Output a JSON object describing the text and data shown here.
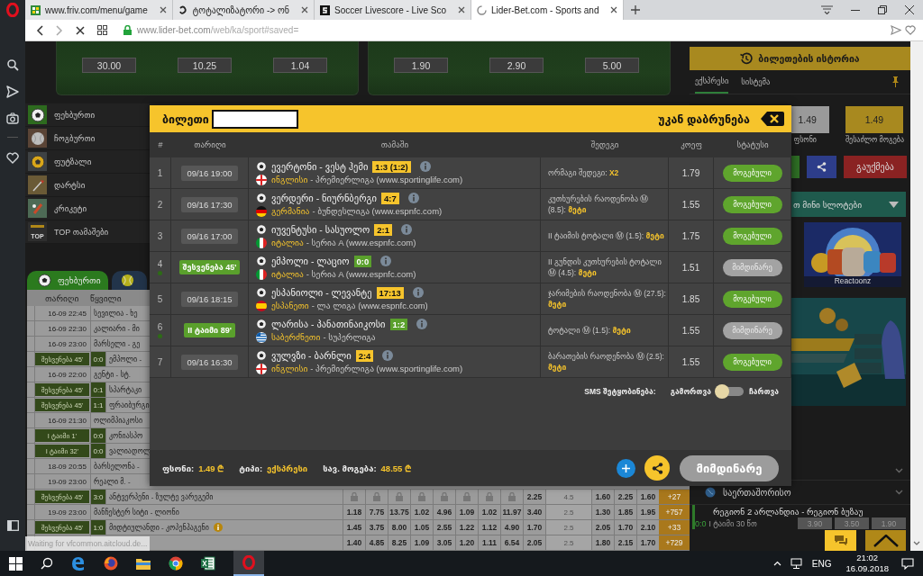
{
  "browser": {
    "tabs": [
      {
        "title": "www.friv.com/menu/game",
        "kind": "friv",
        "selected": false
      },
      {
        "title": "ტოტალიზატორი -> ონ",
        "kind": "letter",
        "selected": false
      },
      {
        "title": "Soccer Livescore - Live Sco",
        "kind": "soccer",
        "selected": false
      },
      {
        "title": "Lider-Bet.com - Sports and",
        "kind": "loading",
        "selected": true
      }
    ],
    "address": {
      "host": "www.lider-bet.com",
      "path": "/web/ka/sport#saved="
    }
  },
  "match_cards": [
    {
      "odds": [
        "30.00",
        "10.25",
        "1.04"
      ]
    },
    {
      "odds": [
        "1.90",
        "2.90",
        "5.00"
      ]
    }
  ],
  "sports": [
    {
      "name": "ფეხბურთი",
      "kind": "football"
    },
    {
      "name": "ჩოგბურთი",
      "kind": "tennis"
    },
    {
      "name": "ფუტზალი",
      "kind": "futsal"
    },
    {
      "name": "დარტსი",
      "kind": "darts"
    },
    {
      "name": "კრიკეტი",
      "kind": "cricket"
    },
    {
      "name": "TOP თამაშები",
      "kind": "top",
      "badge": "TOP"
    }
  ],
  "sport_tabs": [
    {
      "name": "ფეხბურთი",
      "kind": "football",
      "selected": true
    },
    {
      "kind": "tennis",
      "selected": false
    }
  ],
  "events": {
    "columns": [
      "თარიღი",
      "წყვილი"
    ],
    "rows": [
      {
        "live": false,
        "time": "16-09 22:45",
        "match": "სევილია - ხე"
      },
      {
        "live": false,
        "time": "16-09 22:30",
        "match": "კალიარი - მი"
      },
      {
        "live": false,
        "time": "16-09 23:00",
        "match": "მარსელი - გე"
      },
      {
        "live": true,
        "time": "შესვენება 45'",
        "score": "0:0",
        "match": "ემპოლი -"
      },
      {
        "live": false,
        "time": "16-09 22:00",
        "match": "გენტი - სტ."
      },
      {
        "live": true,
        "time": "შესვენება 45'",
        "score": "0:1",
        "match": "სპარტაკი"
      },
      {
        "live": true,
        "time": "შესვენება 45'",
        "score": "1:1",
        "match": "ფრაიბურგი"
      },
      {
        "live": false,
        "time": "16-09 21:30",
        "match": "ოლიმპიაკოსი"
      },
      {
        "live": true,
        "time": "I ტაიმი 1'",
        "score": "0:0",
        "match": "კონიასპო"
      },
      {
        "live": true,
        "time": "I ტაიმი 32'",
        "score": "0:0",
        "match": "ვალიადოლ"
      },
      {
        "live": false,
        "time": "18-09 20:55",
        "match": "ბარსელონა -"
      },
      {
        "live": false,
        "time": "19-09 23:00",
        "match": "რეალი მ. -"
      },
      {
        "live": true,
        "time": "შესვენება 45'",
        "score": "3:0",
        "match": "ანტვერპენი - ზულტე ვარეგემი",
        "odds": [
          {
            "locked": true
          },
          {
            "locked": true
          },
          {
            "locked": true
          },
          {
            "locked": true
          },
          {
            "locked": true
          },
          {
            "locked": true
          },
          {
            "locked": true
          },
          {
            "locked": true
          },
          {
            "locked": false,
            "value": "2.25"
          }
        ],
        "total": "4.5",
        "odds2": [
          "1.60",
          "2.25",
          "1.60"
        ],
        "more": "+27"
      },
      {
        "live": false,
        "time": "19-09 23:00",
        "match": "მანჩესტერ სიტი - ლიონი",
        "odds": [
          {
            "locked": false,
            "value": "1.18"
          },
          {
            "locked": false,
            "value": "7.75"
          },
          {
            "locked": false,
            "value": "13.75"
          },
          {
            "locked": false,
            "value": "1.02"
          },
          {
            "locked": false,
            "value": "4.96"
          },
          {
            "locked": false,
            "value": "1.09"
          },
          {
            "locked": false,
            "value": "1.02"
          },
          {
            "locked": false,
            "value": "11.97"
          },
          {
            "locked": false,
            "value": "3.40"
          }
        ],
        "total": "2.5",
        "odds2": [
          "1.30",
          "1.85",
          "1.95"
        ],
        "more": "+757"
      },
      {
        "live": true,
        "time": "შესვენება 45'",
        "score": "1:0",
        "match": "მიდტიულანდი - კოპენჰაგენი",
        "info": true,
        "odds": [
          {
            "locked": false,
            "value": "1.45"
          },
          {
            "locked": false,
            "value": "3.75"
          },
          {
            "locked": false,
            "value": "8.00"
          },
          {
            "locked": false,
            "value": "1.05"
          },
          {
            "locked": false,
            "value": "2.55"
          },
          {
            "locked": false,
            "value": "1.22"
          },
          {
            "locked": false,
            "value": "1.12"
          },
          {
            "locked": false,
            "value": "4.90"
          },
          {
            "locked": false,
            "value": "1.70"
          }
        ],
        "total": "2.5",
        "odds2": [
          "2.05",
          "1.70",
          "2.10"
        ],
        "more": "+33"
      },
      {
        "odds": [
          {
            "locked": false,
            "value": "1.40"
          },
          {
            "locked": false,
            "value": "4.85"
          },
          {
            "locked": false,
            "value": "8.25"
          },
          {
            "locked": false,
            "value": "1.09"
          },
          {
            "locked": false,
            "value": "3.05"
          },
          {
            "locked": false,
            "value": "1.20"
          },
          {
            "locked": false,
            "value": "1.11"
          },
          {
            "locked": false,
            "value": "6.54"
          },
          {
            "locked": false,
            "value": "2.05"
          }
        ],
        "total": "2.5",
        "odds2": [
          "1.80",
          "2.15",
          "1.70"
        ],
        "more": "+729"
      }
    ]
  },
  "right_panel": {
    "history_button": "ბილეთების ისტორია",
    "ticket_tabs": [
      {
        "label": "ექსპრესი",
        "selected": true
      },
      {
        "label": "სისტემა",
        "selected": false
      }
    ],
    "stake": {
      "value": "1.49",
      "label": "ფსონი"
    },
    "possible_win": {
      "value": "1.49",
      "label": "შესაძლო მოგება"
    },
    "cancel_button": "გაუქმება",
    "slots_banner": "თ მინი სლოტები",
    "game_tile": "Reactoonz",
    "live_section": {
      "category": "საერთაშორისო",
      "match": "რეგიონ 2 არლანდია - რეგიონ ბუზაუ",
      "score": "0:0",
      "period": "I ტაიმი 30 წთ",
      "odds": [
        "3.90",
        "3.50",
        "1.90"
      ]
    }
  },
  "ticket": {
    "title": "ბილეთი",
    "back": "უკან დაბრუნება",
    "columns": [
      "#",
      "თარიღი",
      "თამაში",
      "შედეგი",
      "კოეფ",
      "სტატუსი"
    ],
    "bets": [
      {
        "n": "1",
        "live": false,
        "time": "09/16 19:00",
        "match": "ევერტონი - ვესტ ჰემი",
        "score": "1:3 (1:2)",
        "flag": {
          "kind": "england"
        },
        "country": "ინგლისი",
        "league": "- პრემიერლიგა (www.sportinglife.com)",
        "bet": "ორმაგი შედეგი:",
        "pick": "X2",
        "odd": "1.79",
        "status": "მოგებული",
        "kind": "won"
      },
      {
        "n": "2",
        "live": false,
        "time": "09/16 17:30",
        "match": "ვერდერი - ნიურნბერგი",
        "score": "4:7",
        "flag": {
          "kind": "germany"
        },
        "country": "გერმანია",
        "league": "- ბუნდესლიგა (www.espnfc.com)",
        "bet": "კუთხურების რაოდენობა Ⓜ (8.5):",
        "pick": "მეტი",
        "odd": "1.55",
        "status": "მოგებული",
        "kind": "won"
      },
      {
        "n": "3",
        "live": false,
        "time": "09/16 17:00",
        "match": "იუვენტუსი - სასუოლო",
        "score": "2:1",
        "flag": {
          "kind": "italy"
        },
        "country": "იტალია",
        "league": "- სერია A (www.espnfc.com)",
        "bet": "II ტაიმის ტოტალი Ⓜ (1.5):",
        "pick": "მეტი",
        "odd": "1.75",
        "status": "მოგებული",
        "kind": "won"
      },
      {
        "n": "4",
        "live": true,
        "time": "შესვენება 45'",
        "match": "ემპოლი - ლაციო",
        "score": "0:0",
        "flag": {
          "kind": "italy"
        },
        "country": "იტალია",
        "league": "- სერია A (www.espnfc.com)",
        "bet": "II გუნდის კუთხურების ტოტალი Ⓜ (4.5):",
        "pick": "მეტი",
        "odd": "1.51",
        "status": "მიმდინარე",
        "kind": "pending"
      },
      {
        "n": "5",
        "live": false,
        "time": "09/16 18:15",
        "match": "ესპანიოლი - ლევანტე",
        "score": "17:13",
        "flag": {
          "kind": "spain"
        },
        "country": "ესპანეთი",
        "league": "- ლა ლიგა (www.espnfc.com)",
        "bet": "ჯარიმების რაოდენობა Ⓜ (27.5):",
        "pick": "მეტი",
        "odd": "1.85",
        "status": "მოგებული",
        "kind": "won"
      },
      {
        "n": "6",
        "live": true,
        "time": "II ტაიმი 89'",
        "match": "ლარისა - პანათინაიკოსი",
        "score": "1:2",
        "flag": {
          "kind": "greece"
        },
        "country": "საბერძნეთი",
        "league": "- სუპერლიგა",
        "bet": "ტოტალი Ⓜ (1.5):",
        "pick": "მეტი",
        "odd": "1.55",
        "status": "მიმდინარე",
        "kind": "pending"
      },
      {
        "n": "7",
        "live": false,
        "time": "09/16 16:30",
        "match": "ვულვზი - ბარნლი",
        "score": "2:4",
        "flag": {
          "kind": "england"
        },
        "country": "ინგლისი",
        "league": "- პრემიერლიგა (www.sportinglife.com)",
        "bet": "ბარათების რაოდენობა Ⓜ (2.5):",
        "pick": "მეტი",
        "odd": "1.55",
        "status": "მოგებული",
        "kind": "won"
      }
    ],
    "sms": {
      "label": "SMS შეტყობინება:",
      "off_label": "გამორთვა",
      "on_label": "ჩართვა",
      "on": false
    },
    "summary": [
      {
        "label": "ფსონი:",
        "value": "1.49 ₾"
      },
      {
        "label": "ტიპი:",
        "value": "ექსპრესი"
      },
      {
        "label": "სავ. მოგება:",
        "value": "48.55 ₾"
      }
    ],
    "status_button": "მიმდინარე"
  },
  "status_bubble": "Waiting for vfcommon.aitcloud.de...",
  "taskbar": {
    "language": "ENG",
    "time": "21:02",
    "date": "16.09.2018"
  }
}
